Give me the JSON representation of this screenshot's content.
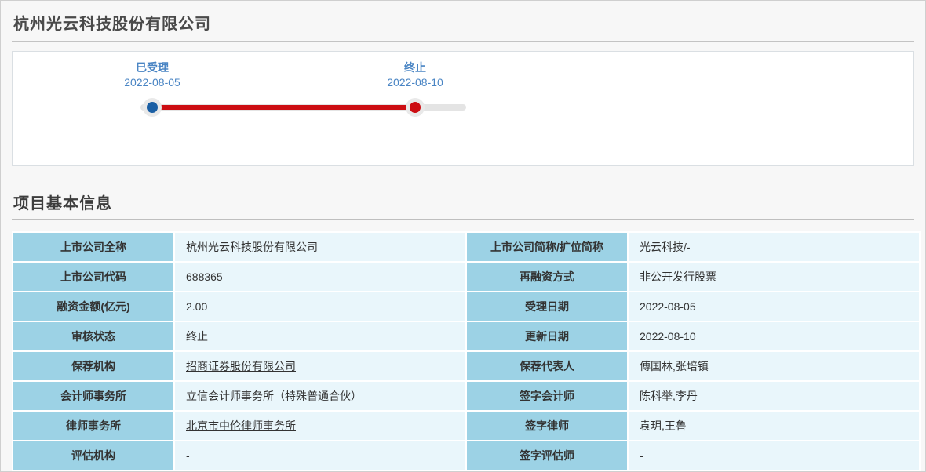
{
  "page": {
    "title": "杭州光云科技股份有限公司",
    "section_title": "项目基本信息"
  },
  "timeline": {
    "stages": [
      {
        "label": "已受理",
        "date": "2022-08-05",
        "dot_color": "#1b5fa4"
      },
      {
        "label": "终止",
        "date": "2022-08-10",
        "dot_color": "#cc0d12"
      }
    ]
  },
  "colors": {
    "timeline_text_blue": "#4a85c4",
    "progress_red": "#cc0d12",
    "accepted_dot_blue": "#1b5fa4",
    "track_gray": "#e4e4e4",
    "label_cell_bg": "#9cd2e5",
    "value_cell_bg": "#e9f6fb"
  },
  "table": {
    "rows": [
      {
        "cells": [
          {
            "label": "上市公司全称",
            "value": "杭州光云科技股份有限公司",
            "link": false
          },
          {
            "label": "上市公司简称/扩位简称",
            "value": "光云科技/-",
            "link": false
          }
        ]
      },
      {
        "cells": [
          {
            "label": "上市公司代码",
            "value": "688365",
            "link": false
          },
          {
            "label": "再融资方式",
            "value": "非公开发行股票",
            "link": false
          }
        ]
      },
      {
        "cells": [
          {
            "label": "融资金额(亿元)",
            "value": "2.00",
            "link": false
          },
          {
            "label": "受理日期",
            "value": "2022-08-05",
            "link": false
          }
        ]
      },
      {
        "cells": [
          {
            "label": "审核状态",
            "value": "终止",
            "link": false
          },
          {
            "label": "更新日期",
            "value": "2022-08-10",
            "link": false
          }
        ]
      },
      {
        "cells": [
          {
            "label": "保荐机构",
            "value": "招商证券股份有限公司",
            "link": true
          },
          {
            "label": "保荐代表人",
            "value": "傅国林,张培镇",
            "link": false
          }
        ]
      },
      {
        "cells": [
          {
            "label": "会计师事务所",
            "value": "立信会计师事务所（特殊普通合伙）",
            "link": true
          },
          {
            "label": "签字会计师",
            "value": "陈科举,李丹",
            "link": false
          }
        ]
      },
      {
        "cells": [
          {
            "label": "律师事务所",
            "value": "北京市中伦律师事务所",
            "link": true
          },
          {
            "label": "签字律师",
            "value": "袁玥,王鲁",
            "link": false
          }
        ]
      },
      {
        "cells": [
          {
            "label": "评估机构",
            "value": "-",
            "link": false
          },
          {
            "label": "签字评估师",
            "value": "-",
            "link": false
          }
        ]
      }
    ]
  }
}
